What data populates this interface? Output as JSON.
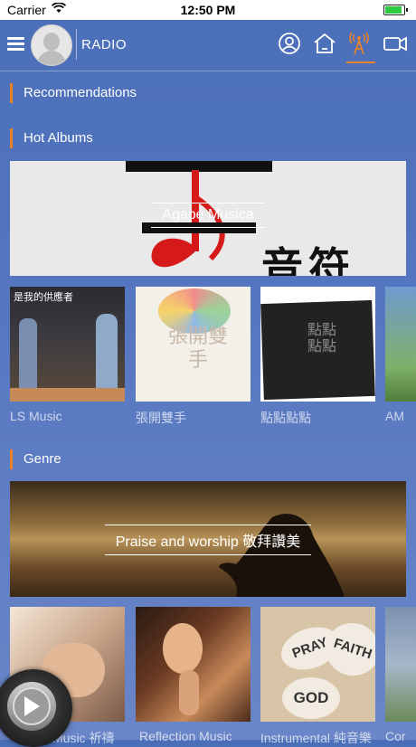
{
  "status_bar": {
    "carrier": "Carrier",
    "time": "12:50 PM",
    "battery_level": 0.9
  },
  "header": {
    "title": "RADIO",
    "icons": [
      "user-circle-icon",
      "home-icon",
      "radio-tower-icon",
      "video-camera-icon"
    ],
    "active_icon": "radio-tower-icon"
  },
  "sections": {
    "recommendations": "Recommendations",
    "hot_albums": "Hot Albums",
    "genre": "Genre"
  },
  "hot_albums_banner": {
    "title": "Agape Musica",
    "image_text": "音符"
  },
  "albums": [
    {
      "label": "LS Music",
      "image_text": "是我的供應者"
    },
    {
      "label": "張開雙手",
      "image_text": "張開雙手"
    },
    {
      "label": "點點點點",
      "image_text": "點點點點"
    },
    {
      "label": "AM"
    }
  ],
  "genre_banner": {
    "title": "Praise and worship 敬拜讚美"
  },
  "genres": [
    {
      "label": "Music 祈禱"
    },
    {
      "label": "Reflection Music"
    },
    {
      "label": "Instrumental 純音樂",
      "image_words": [
        "PRAY",
        "FAITH",
        "GOD"
      ]
    },
    {
      "label": "Cor"
    }
  ],
  "colors": {
    "accent": "#e8822a",
    "background": "#5576c0"
  }
}
